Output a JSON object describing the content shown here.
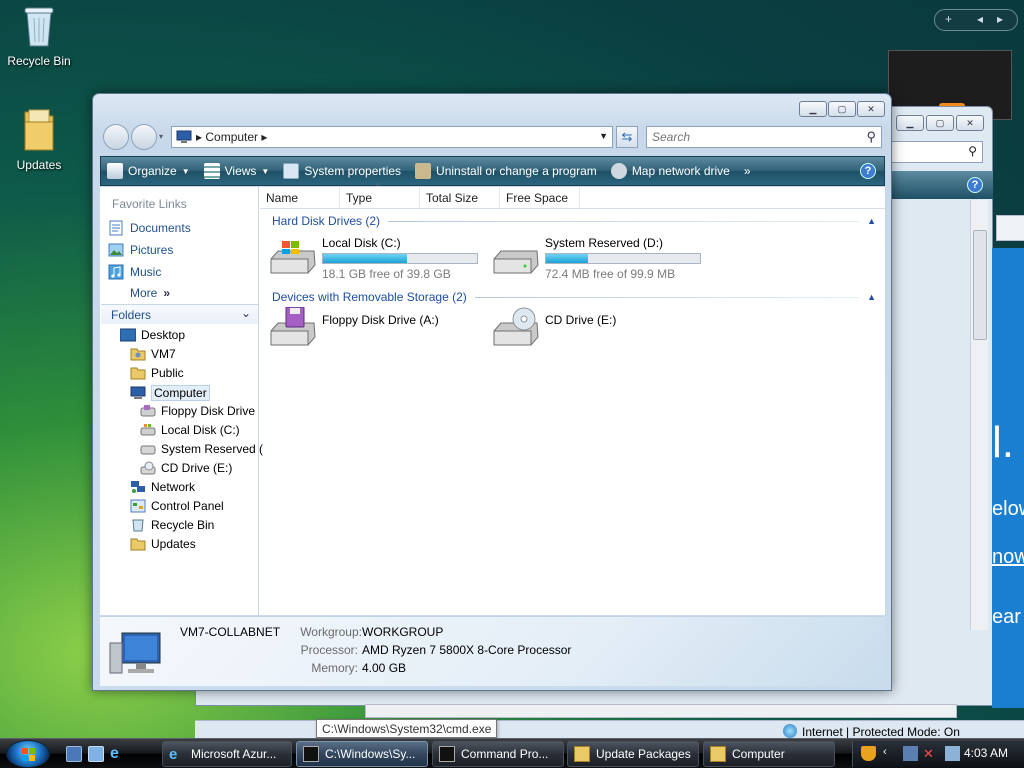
{
  "desktop": {
    "icons": [
      {
        "label": "Recycle Bin",
        "icon": "recycle-bin-icon"
      },
      {
        "label": "Updates",
        "icon": "folder-icon"
      }
    ]
  },
  "explorer": {
    "address": {
      "crumb": "Computer"
    },
    "search": {
      "placeholder": "Search"
    },
    "toolbar": {
      "organize": "Organize",
      "views": "Views",
      "system_properties": "System properties",
      "uninstall": "Uninstall or change a program",
      "map_drive": "Map network drive",
      "more": "»"
    },
    "favorites": {
      "title": "Favorite Links",
      "items": [
        "Documents",
        "Pictures",
        "Music"
      ],
      "more": "More"
    },
    "folders": {
      "title": "Folders",
      "tree": [
        "Desktop",
        "VM7",
        "Public",
        "Computer",
        "Floppy Disk Drive",
        "Local Disk (C:)",
        "System Reserved (",
        "CD Drive (E:)",
        "Network",
        "Control Panel",
        "Recycle Bin",
        "Updates"
      ]
    },
    "columns": [
      "Name",
      "Type",
      "Total Size",
      "Free Space"
    ],
    "groups": [
      {
        "title": "Hard Disk Drives (2)",
        "drives": [
          {
            "name": "Local Disk (C:)",
            "free": "18.1 GB free of 39.8 GB",
            "used_fraction": 0.545
          },
          {
            "name": "System Reserved (D:)",
            "free": "72.4 MB free of 99.9 MB",
            "used_fraction": 0.275
          }
        ]
      },
      {
        "title": "Devices with Removable Storage (2)",
        "drives": [
          {
            "name": "Floppy Disk Drive (A:)"
          },
          {
            "name": "CD Drive (E:)"
          }
        ]
      }
    ],
    "details": {
      "pc_name": "VM7-COLLABNET",
      "workgroup_label": "Workgroup:",
      "workgroup": "WORKGROUP",
      "processor_label": "Processor:",
      "processor": "AMD Ryzen 7 5800X 8-Core Processor",
      "memory_label": "Memory:",
      "memory": "4.00 GB"
    }
  },
  "ie": {
    "status": "Internet | Protected Mode: On",
    "blue_text": [
      "l.",
      "elow",
      "now",
      "ear"
    ]
  },
  "tooltip": "C:\\Windows\\System32\\cmd.exe",
  "taskbar": {
    "buttons": [
      "Microsoft Azur...",
      "C:\\Windows\\Sy...",
      "Command Pro...",
      "Update Packages",
      "Computer"
    ],
    "clock": "4:03 AM"
  },
  "gadget": {
    "plus": "+",
    "prev": "◂",
    "next": "▸"
  },
  "colors": {
    "toolbar": "#2f6076",
    "link": "#1f4f8c",
    "group": "#1e4ea0",
    "bar_fill": "#1aa3d6"
  }
}
